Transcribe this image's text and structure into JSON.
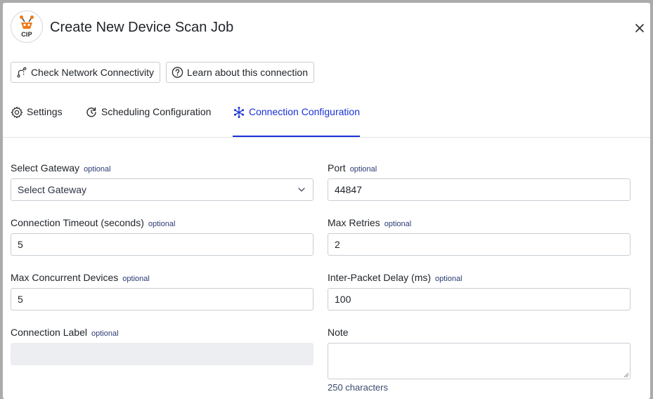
{
  "dialog": {
    "logo_text": "CIP",
    "title": "Create New Device Scan Job"
  },
  "actions": {
    "check_connectivity": "Check Network Connectivity",
    "learn_connection": "Learn about this connection"
  },
  "tabs": [
    {
      "label": "Settings",
      "icon": "gear-icon"
    },
    {
      "label": "Scheduling Configuration",
      "icon": "refresh-clock-icon"
    },
    {
      "label": "Connection Configuration",
      "icon": "network-icon",
      "active": true
    }
  ],
  "optional_tag": "optional",
  "fields": {
    "gateway": {
      "label": "Select Gateway",
      "placeholder": "Select Gateway"
    },
    "port": {
      "label": "Port",
      "value": "44847"
    },
    "timeout": {
      "label": "Connection Timeout (seconds)",
      "value": "5"
    },
    "max_retries": {
      "label": "Max Retries",
      "value": "2"
    },
    "max_concurrent": {
      "label": "Max Concurrent Devices",
      "value": "5"
    },
    "inter_packet_delay": {
      "label": "Inter-Packet Delay (ms)",
      "value": "100"
    },
    "connection_label": {
      "label": "Connection Label",
      "value": ""
    },
    "note": {
      "label": "Note",
      "value": "",
      "char_count": "250 characters"
    }
  },
  "colors": {
    "accent": "#1a31d8",
    "logo_orange": "#f07a1a"
  }
}
